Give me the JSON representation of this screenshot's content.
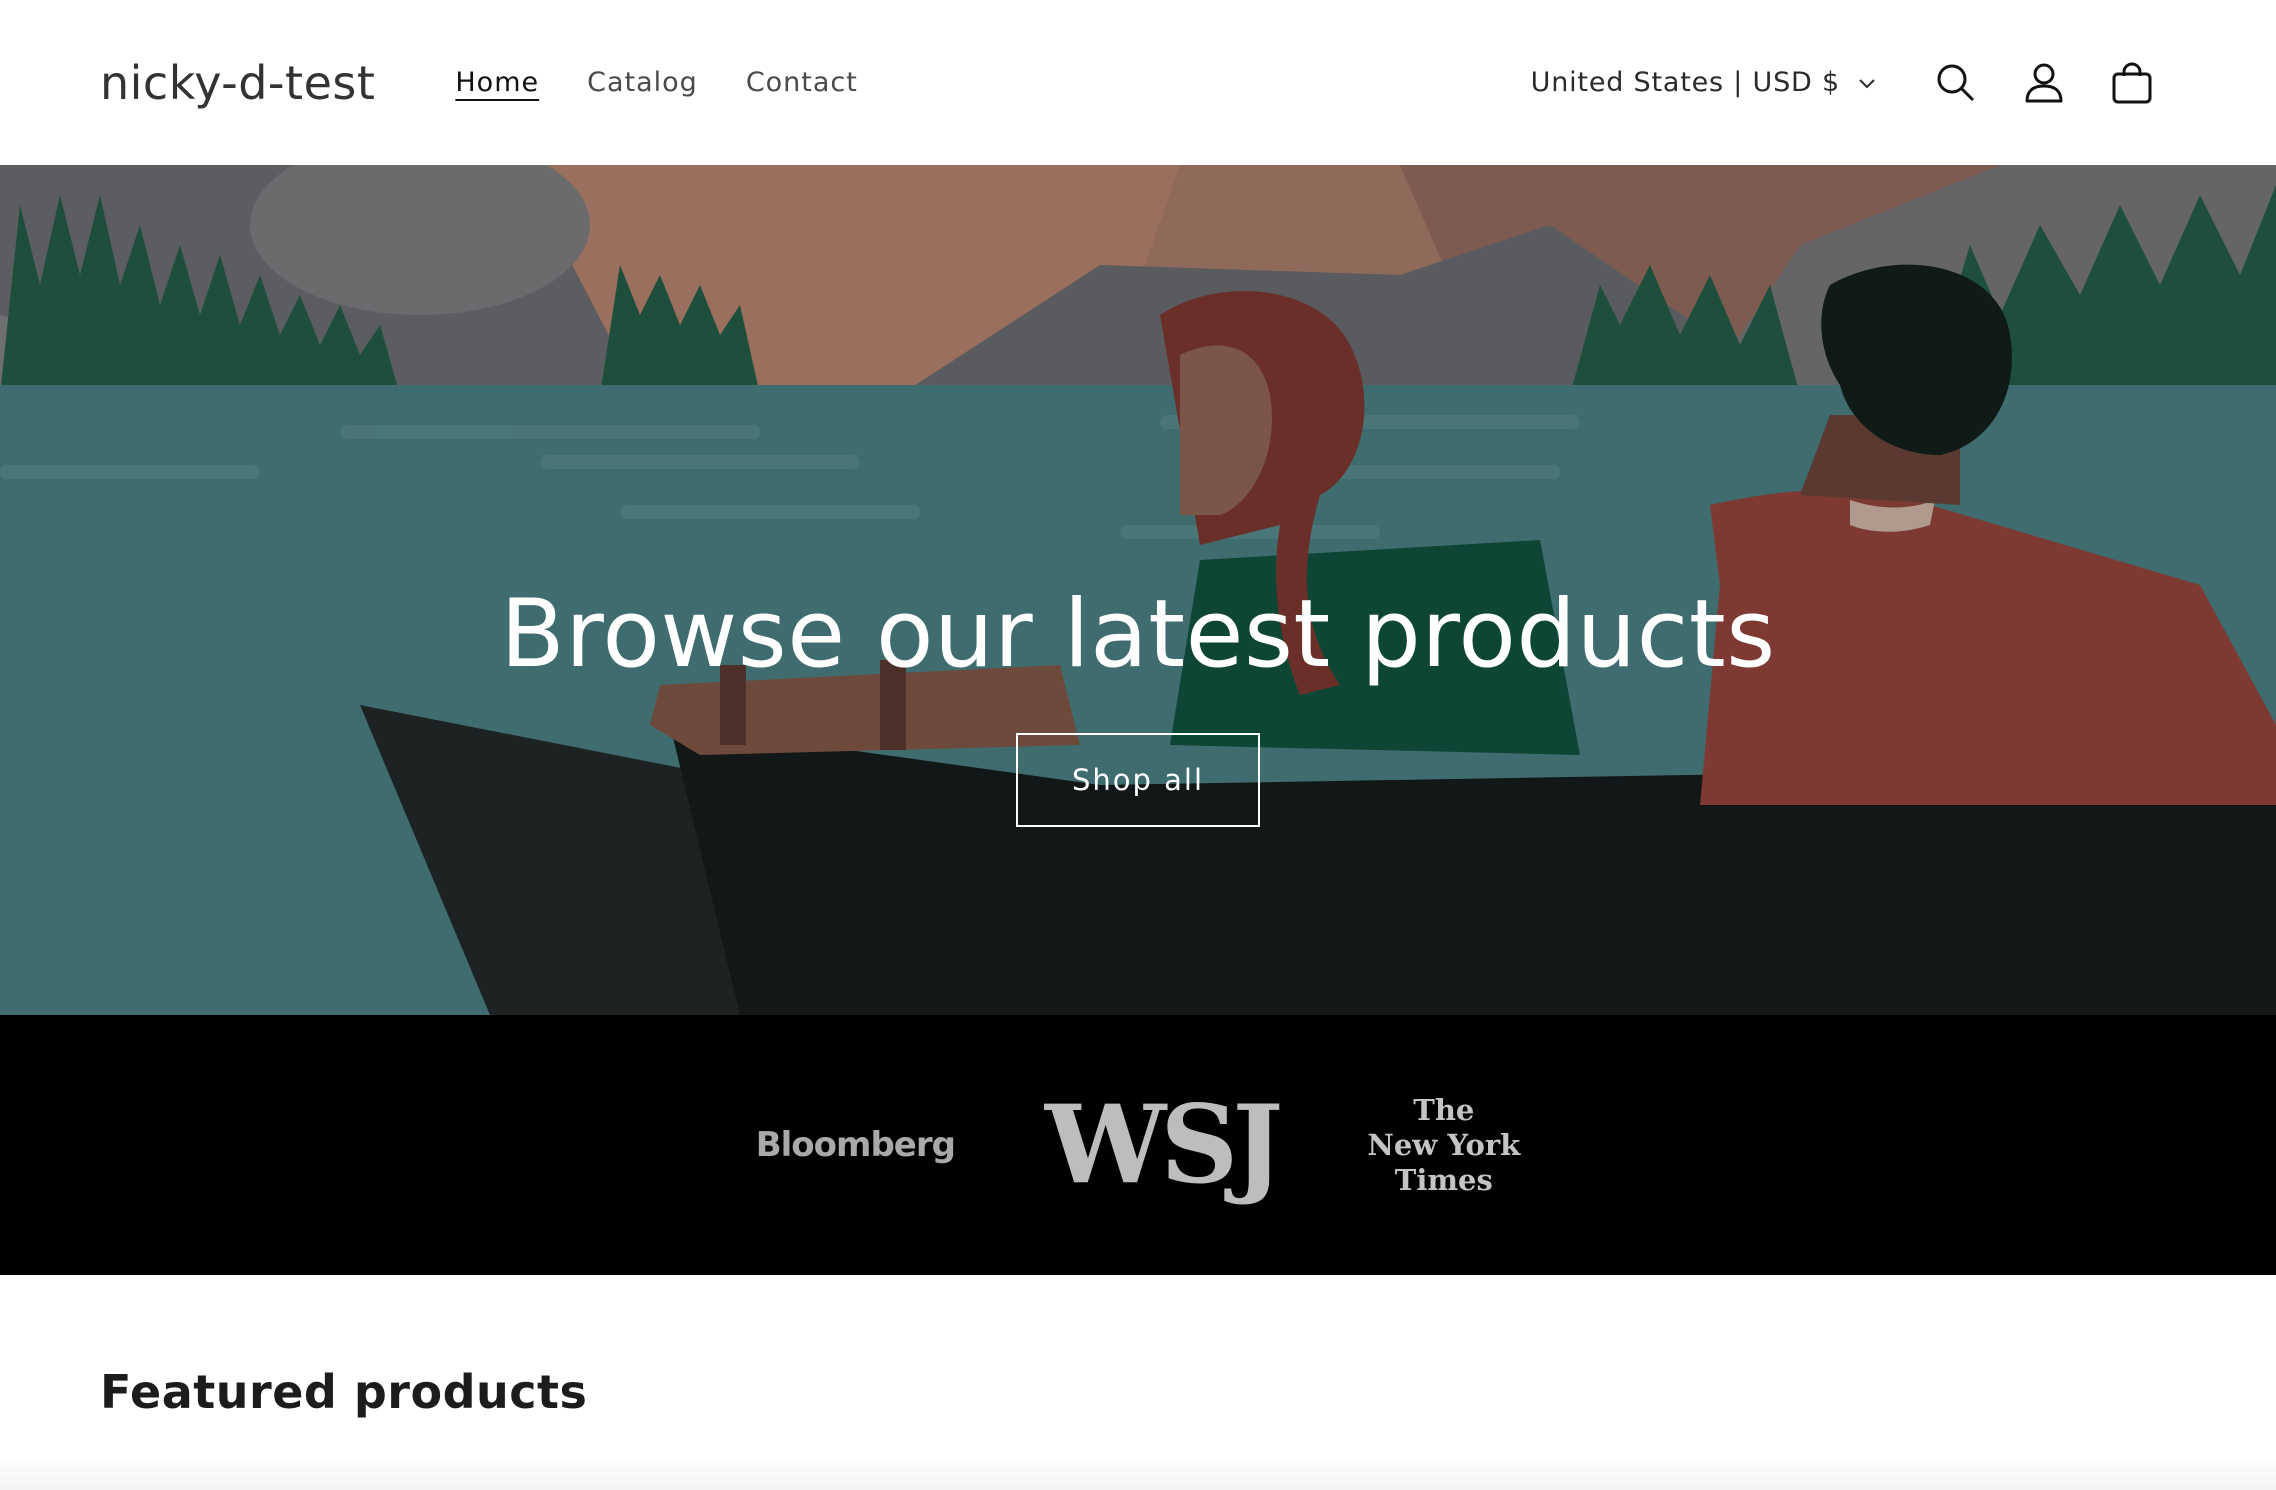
{
  "header": {
    "logo": "nicky-d-test",
    "nav": [
      {
        "label": "Home",
        "active": true
      },
      {
        "label": "Catalog",
        "active": false
      },
      {
        "label": "Contact",
        "active": false
      }
    ],
    "locale": "United States | USD $",
    "icons": [
      "chevron-down-icon",
      "search-icon",
      "account-icon",
      "cart-icon"
    ]
  },
  "hero": {
    "title": "Browse our latest products",
    "button_label": "Shop all"
  },
  "press": {
    "logos": [
      "Bloomberg",
      "WSJ",
      "The New York Times"
    ],
    "nyt_lines": [
      "The",
      "New York",
      "Times"
    ]
  },
  "featured": {
    "title": "Featured products"
  }
}
